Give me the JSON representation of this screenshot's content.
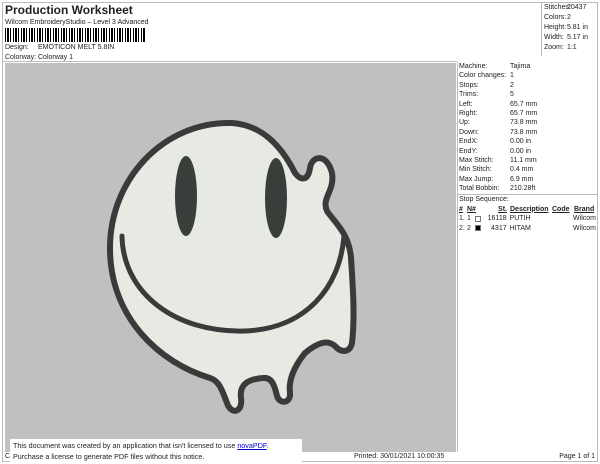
{
  "header": {
    "title": "Production Worksheet",
    "subtitle": "Wilcom EmbroideryStudio – Level 3 Advanced",
    "design_label": "Design:",
    "design": "EMOTICON MELT 5.8IN",
    "colorway_label": "Colorway:",
    "colorway": "Colorway 1"
  },
  "stats": [
    {
      "k": "Stitches:",
      "v": "20437"
    },
    {
      "k": "Colors:",
      "v": "2"
    },
    {
      "k": "Height:",
      "v": "5.81 in"
    },
    {
      "k": "Width:",
      "v": "5.17 in"
    },
    {
      "k": "Zoom:",
      "v": "1:1"
    }
  ],
  "info": [
    {
      "k": "Machine:",
      "v": "Tajima"
    },
    {
      "k": "Color changes:",
      "v": "1"
    },
    {
      "k": "Stops:",
      "v": "2"
    },
    {
      "k": "Trims:",
      "v": "5"
    },
    {
      "k": "Left:",
      "v": "65.7 mm"
    },
    {
      "k": "Right:",
      "v": "65.7 mm"
    },
    {
      "k": "Up:",
      "v": "73.8 mm"
    },
    {
      "k": "Down:",
      "v": "73.8 mm"
    },
    {
      "k": "EndX:",
      "v": "0.00 in"
    },
    {
      "k": "EndY:",
      "v": "0.00 in"
    },
    {
      "k": "Max Stitch:",
      "v": "11.1 mm"
    },
    {
      "k": "Min Stitch:",
      "v": "0.4 mm"
    },
    {
      "k": "Max Jump:",
      "v": "6.9 mm"
    },
    {
      "k": "Total Bobbin:",
      "v": "210.28ft"
    }
  ],
  "stop_sequence": {
    "label": "Stop Sequence:",
    "columns": [
      "#",
      "N#",
      "St.",
      "Description",
      "Code",
      "Brand"
    ],
    "rows": [
      {
        "n": "1.",
        "nn": "1",
        "color": "#ffffff",
        "st": "16118",
        "desc": "PUTIH",
        "code": "",
        "brand": "Wilcom"
      },
      {
        "n": "2.",
        "nn": "2",
        "color": "#000000",
        "st": "4317",
        "desc": "HITAM",
        "code": "",
        "brand": "Wilcom"
      }
    ]
  },
  "design_colors": {
    "fill": "#e9ede6",
    "outline": "#3a3a3a",
    "background": "#c0c0c0"
  },
  "footer": {
    "left": "Cr",
    "printed": "Printed: 30/01/2021 10:00:35",
    "page": "Page 1 of 1"
  },
  "notice": {
    "line1": "This document was created by an application that isn't licensed to use ",
    "link": "novaPDF",
    "line1_end": ".",
    "line2": "Purchase a license to generate PDF files without this notice."
  }
}
